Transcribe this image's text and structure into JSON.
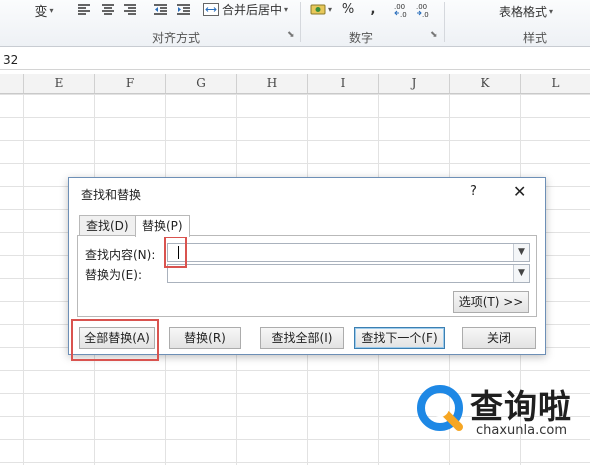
{
  "ribbon": {
    "wrap_char": "变",
    "merge_center_label": "合并后居中",
    "percent_symbol": "%",
    "comma_symbol": ",",
    "increase_decimal": ".00→.0",
    "decrease_decimal": ".00→.0",
    "table_format_label": "表格格式",
    "groups": {
      "alignment": "对齐方式",
      "number": "数字",
      "styles": "样式"
    }
  },
  "formula_bar": {
    "value": "32"
  },
  "columns": [
    "E",
    "F",
    "G",
    "H",
    "I",
    "J",
    "K",
    "L"
  ],
  "dialog": {
    "title": "查找和替换",
    "help_glyph": "?",
    "close_glyph": "✕",
    "tabs": [
      {
        "label": "查找(D)",
        "active": false
      },
      {
        "label": "替换(P)",
        "active": true
      }
    ],
    "find_label": "查找内容(N):",
    "find_value": "",
    "replace_label": "替换为(E):",
    "replace_value": "",
    "options_button": "选项(T) >>",
    "buttons": {
      "replace_all": "全部替换(A)",
      "replace": "替换(R)",
      "find_all": "查找全部(I)",
      "find_next": "查找下一个(F)",
      "close": "关闭"
    }
  },
  "watermark": {
    "title": "查询啦",
    "url": "chaxunla.com"
  },
  "colors": {
    "highlight": "#d9534f",
    "dialog_border": "#6d8fb6",
    "accent_blue": "#1e88e5"
  }
}
